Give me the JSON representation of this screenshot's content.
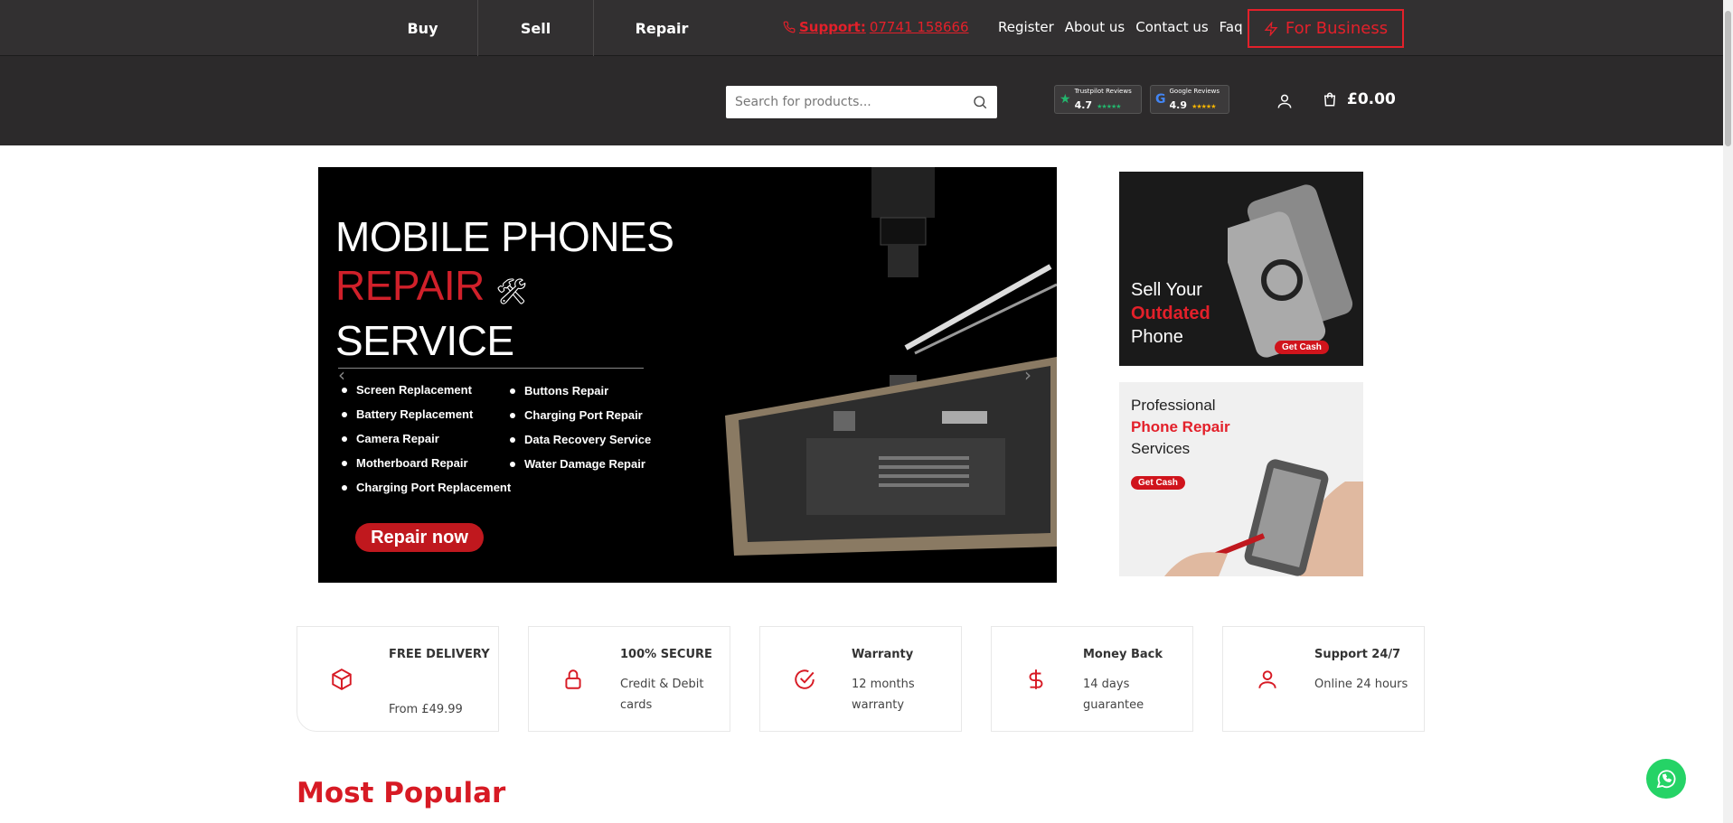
{
  "nav": {
    "buy": "Buy",
    "sell": "Sell",
    "repair": "Repair",
    "support_label": "Support:",
    "support_number": "07741 158666",
    "links": [
      "Register",
      "About us",
      "Contact us",
      "Faq"
    ],
    "for_business": "For Business"
  },
  "search": {
    "placeholder": "Search for products..."
  },
  "reviews": {
    "trustpilot": {
      "label": "Trustpilot Reviews",
      "score": "4.7",
      "stars": "★★★★★"
    },
    "google": {
      "label": "Google Reviews",
      "score": "4.9",
      "stars": "★★★★★"
    }
  },
  "cart": {
    "total": "£0.00"
  },
  "hero": {
    "line1": "MOBILE PHONES",
    "line2": "REPAIR",
    "line3": "SERVICE",
    "list1": [
      "Screen Replacement",
      "Battery Replacement",
      "Camera Repair",
      "Motherboard Repair",
      "Charging Port Replacement"
    ],
    "list2": [
      "Buttons Repair",
      "Charging Port Repair",
      "Data Recovery Service",
      "Water Damage Repair"
    ],
    "cta": "Repair now"
  },
  "promo1": {
    "line1": "Sell Your",
    "line2": "Outdated",
    "line3": "Phone",
    "cta": "Get Cash"
  },
  "promo2": {
    "line1": "Professional",
    "line2": "Phone Repair",
    "line3": "Services",
    "cta": "Get Cash"
  },
  "features": [
    {
      "icon": "box-icon",
      "title": "FREE DELIVERY",
      "sub": "From £49.99"
    },
    {
      "icon": "lock-icon",
      "title": "100% SECURE",
      "sub": "Credit & Debit cards"
    },
    {
      "icon": "check-circle-icon",
      "title": "Warranty",
      "sub": "12 months warranty"
    },
    {
      "icon": "dollar-icon",
      "title": "Money Back",
      "sub": "14 days guarantee"
    },
    {
      "icon": "user-icon",
      "title": "Support 24/7",
      "sub": "Online 24 hours"
    }
  ],
  "section_title": "Most Popular",
  "colors": {
    "accent": "#e3202a",
    "dark_header": "#2c2a2b",
    "whatsapp": "#25d366"
  }
}
